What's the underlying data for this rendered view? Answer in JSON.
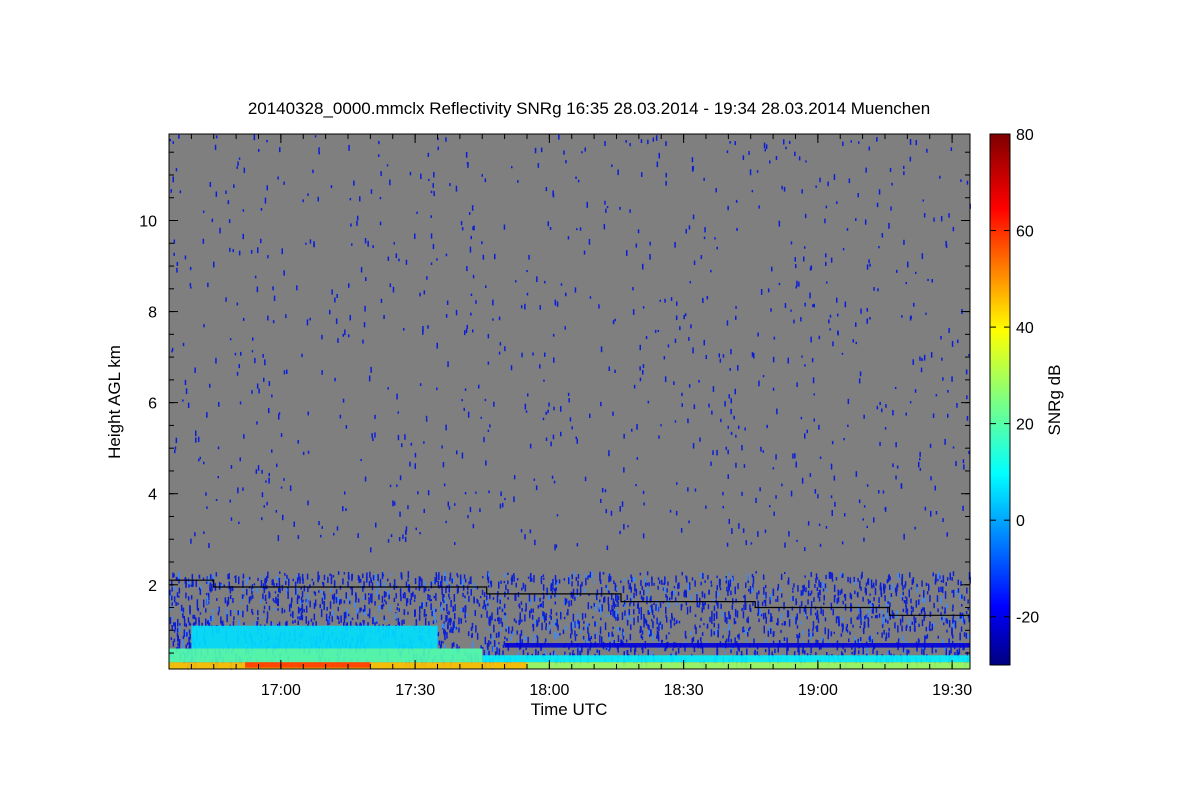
{
  "chart_data": {
    "type": "heatmap",
    "title": "20140328_0000.mmclx Reflectivity SNRg   16:35 28.03.2014 - 19:34 28.03.2014 Muenchen",
    "xlabel": "Time UTC",
    "ylabel": "Height AGL km",
    "colorbar_label": "SNRg dB",
    "xlim_minutes": [
      995,
      1174
    ],
    "ylim": [
      0.15,
      11.9
    ],
    "x_ticks": [
      {
        "value": 1020,
        "label": "17:00"
      },
      {
        "value": 1050,
        "label": "17:30"
      },
      {
        "value": 1080,
        "label": "18:00"
      },
      {
        "value": 1110,
        "label": "18:30"
      },
      {
        "value": 1140,
        "label": "19:00"
      },
      {
        "value": 1170,
        "label": "19:30"
      }
    ],
    "y_ticks": [
      {
        "value": 2,
        "label": "2"
      },
      {
        "value": 4,
        "label": "4"
      },
      {
        "value": 6,
        "label": "6"
      },
      {
        "value": 8,
        "label": "8"
      },
      {
        "value": 10,
        "label": "10"
      }
    ],
    "colorbar_range": [
      -30,
      80
    ],
    "colorbar_ticks": [
      {
        "value": -20,
        "label": "-20"
      },
      {
        "value": 0,
        "label": "0"
      },
      {
        "value": 20,
        "label": "20"
      },
      {
        "value": 40,
        "label": "40"
      },
      {
        "value": 60,
        "label": "60"
      },
      {
        "value": 80,
        "label": "80"
      }
    ],
    "colormap": "jet",
    "background_color": "#7f7f7f",
    "boundary_layer_line": [
      {
        "t": 995,
        "h": 2.1
      },
      {
        "t": 1005,
        "h": 2.1
      },
      {
        "t": 1005,
        "h": 1.95
      },
      {
        "t": 1066,
        "h": 1.95
      },
      {
        "t": 1066,
        "h": 1.8
      },
      {
        "t": 1096,
        "h": 1.8
      },
      {
        "t": 1096,
        "h": 1.63
      },
      {
        "t": 1126,
        "h": 1.63
      },
      {
        "t": 1126,
        "h": 1.5
      },
      {
        "t": 1156,
        "h": 1.5
      },
      {
        "t": 1156,
        "h": 1.33
      },
      {
        "t": 1174,
        "h": 1.33
      }
    ],
    "echo_layers": [
      {
        "t_start": 995,
        "t_end": 1075,
        "h_bottom": 0.15,
        "h_top": 0.3,
        "snr_db": 45
      },
      {
        "t_start": 1012,
        "t_end": 1040,
        "h_bottom": 0.18,
        "h_top": 0.32,
        "snr_db": 60
      },
      {
        "t_start": 995,
        "t_end": 1065,
        "h_bottom": 0.3,
        "h_top": 0.6,
        "snr_db": 20
      },
      {
        "t_start": 1000,
        "t_end": 1055,
        "h_bottom": 0.6,
        "h_top": 1.1,
        "snr_db": 8
      },
      {
        "t_start": 1075,
        "t_end": 1174,
        "h_bottom": 0.15,
        "h_top": 0.3,
        "snr_db": 28
      },
      {
        "t_start": 1065,
        "t_end": 1174,
        "h_bottom": 0.3,
        "h_top": 0.45,
        "snr_db": 10
      },
      {
        "t_start": 1070,
        "t_end": 1174,
        "h_bottom": 0.62,
        "h_top": 0.72,
        "snr_db": -20
      }
    ]
  }
}
